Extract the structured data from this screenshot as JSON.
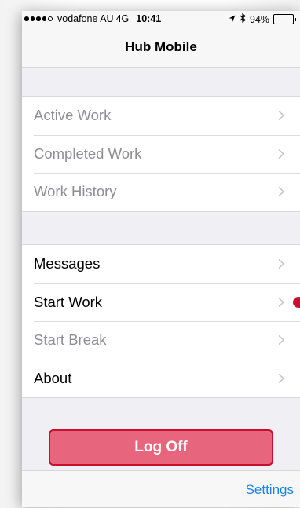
{
  "status_bar": {
    "carrier": "vodafone AU",
    "network": "4G",
    "time": "10:41",
    "battery_percent": "94%",
    "battery_level": 0.94,
    "icons": [
      "signal-icon",
      "location-arrow-icon",
      "bluetooth-icon",
      "battery-icon"
    ]
  },
  "nav": {
    "title": "Hub Mobile"
  },
  "work_section": {
    "items": [
      {
        "label": "Active Work",
        "enabled": false
      },
      {
        "label": "Completed Work",
        "enabled": false
      },
      {
        "label": "Work History",
        "enabled": false
      }
    ]
  },
  "actions_section": {
    "items": [
      {
        "label": "Messages",
        "enabled": true
      },
      {
        "label": "Start Work",
        "enabled": true,
        "badge": true
      },
      {
        "label": "Start Break",
        "enabled": false
      },
      {
        "label": "About",
        "enabled": true
      }
    ]
  },
  "logoff_button": {
    "label": "Log Off"
  },
  "toolbar": {
    "settings_label": "Settings"
  },
  "colors": {
    "accent": "#1a82e8",
    "logoff_fill": "#e8657e",
    "logoff_border": "#c8102e",
    "badge": "#c8102e",
    "disabled_text": "#8e8e93",
    "background": "#efeff4"
  }
}
